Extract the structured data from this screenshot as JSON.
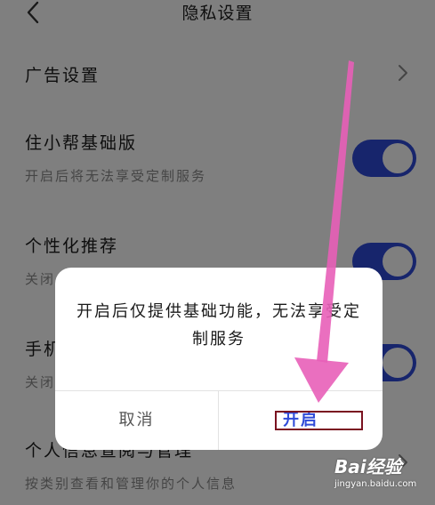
{
  "header": {
    "title": "隐私设置",
    "back_icon": "chevron-left-icon"
  },
  "settings": {
    "ad": {
      "title": "广告设置",
      "icon": "chevron-right-icon"
    },
    "basic": {
      "title": "住小帮基础版",
      "subtitle": "开启后将无法享受定制服务",
      "toggle_on": true
    },
    "personalized": {
      "title": "个性化推荐",
      "subtitle": "关闭",
      "toggle_on": true
    },
    "phone": {
      "title": "手机",
      "subtitle": "关闭",
      "toggle_on": true
    },
    "personal_info": {
      "title": "个人信息查阅与管理",
      "subtitle": "按类别查看和管理你的个人信息",
      "icon": "chevron-right-icon"
    }
  },
  "dialog": {
    "message": "开启后仅提供基础功能，无法享受定制服务",
    "cancel_label": "取消",
    "confirm_label": "开启"
  },
  "colors": {
    "accent": "#2f4ad8",
    "overlay": "rgba(0,0,0,0.5)",
    "annotation_arrow": "#e85fb8",
    "annotation_box": "#7a1220"
  },
  "watermark": {
    "logo": "Bai经验",
    "url": "jingyan.baidu.com"
  }
}
